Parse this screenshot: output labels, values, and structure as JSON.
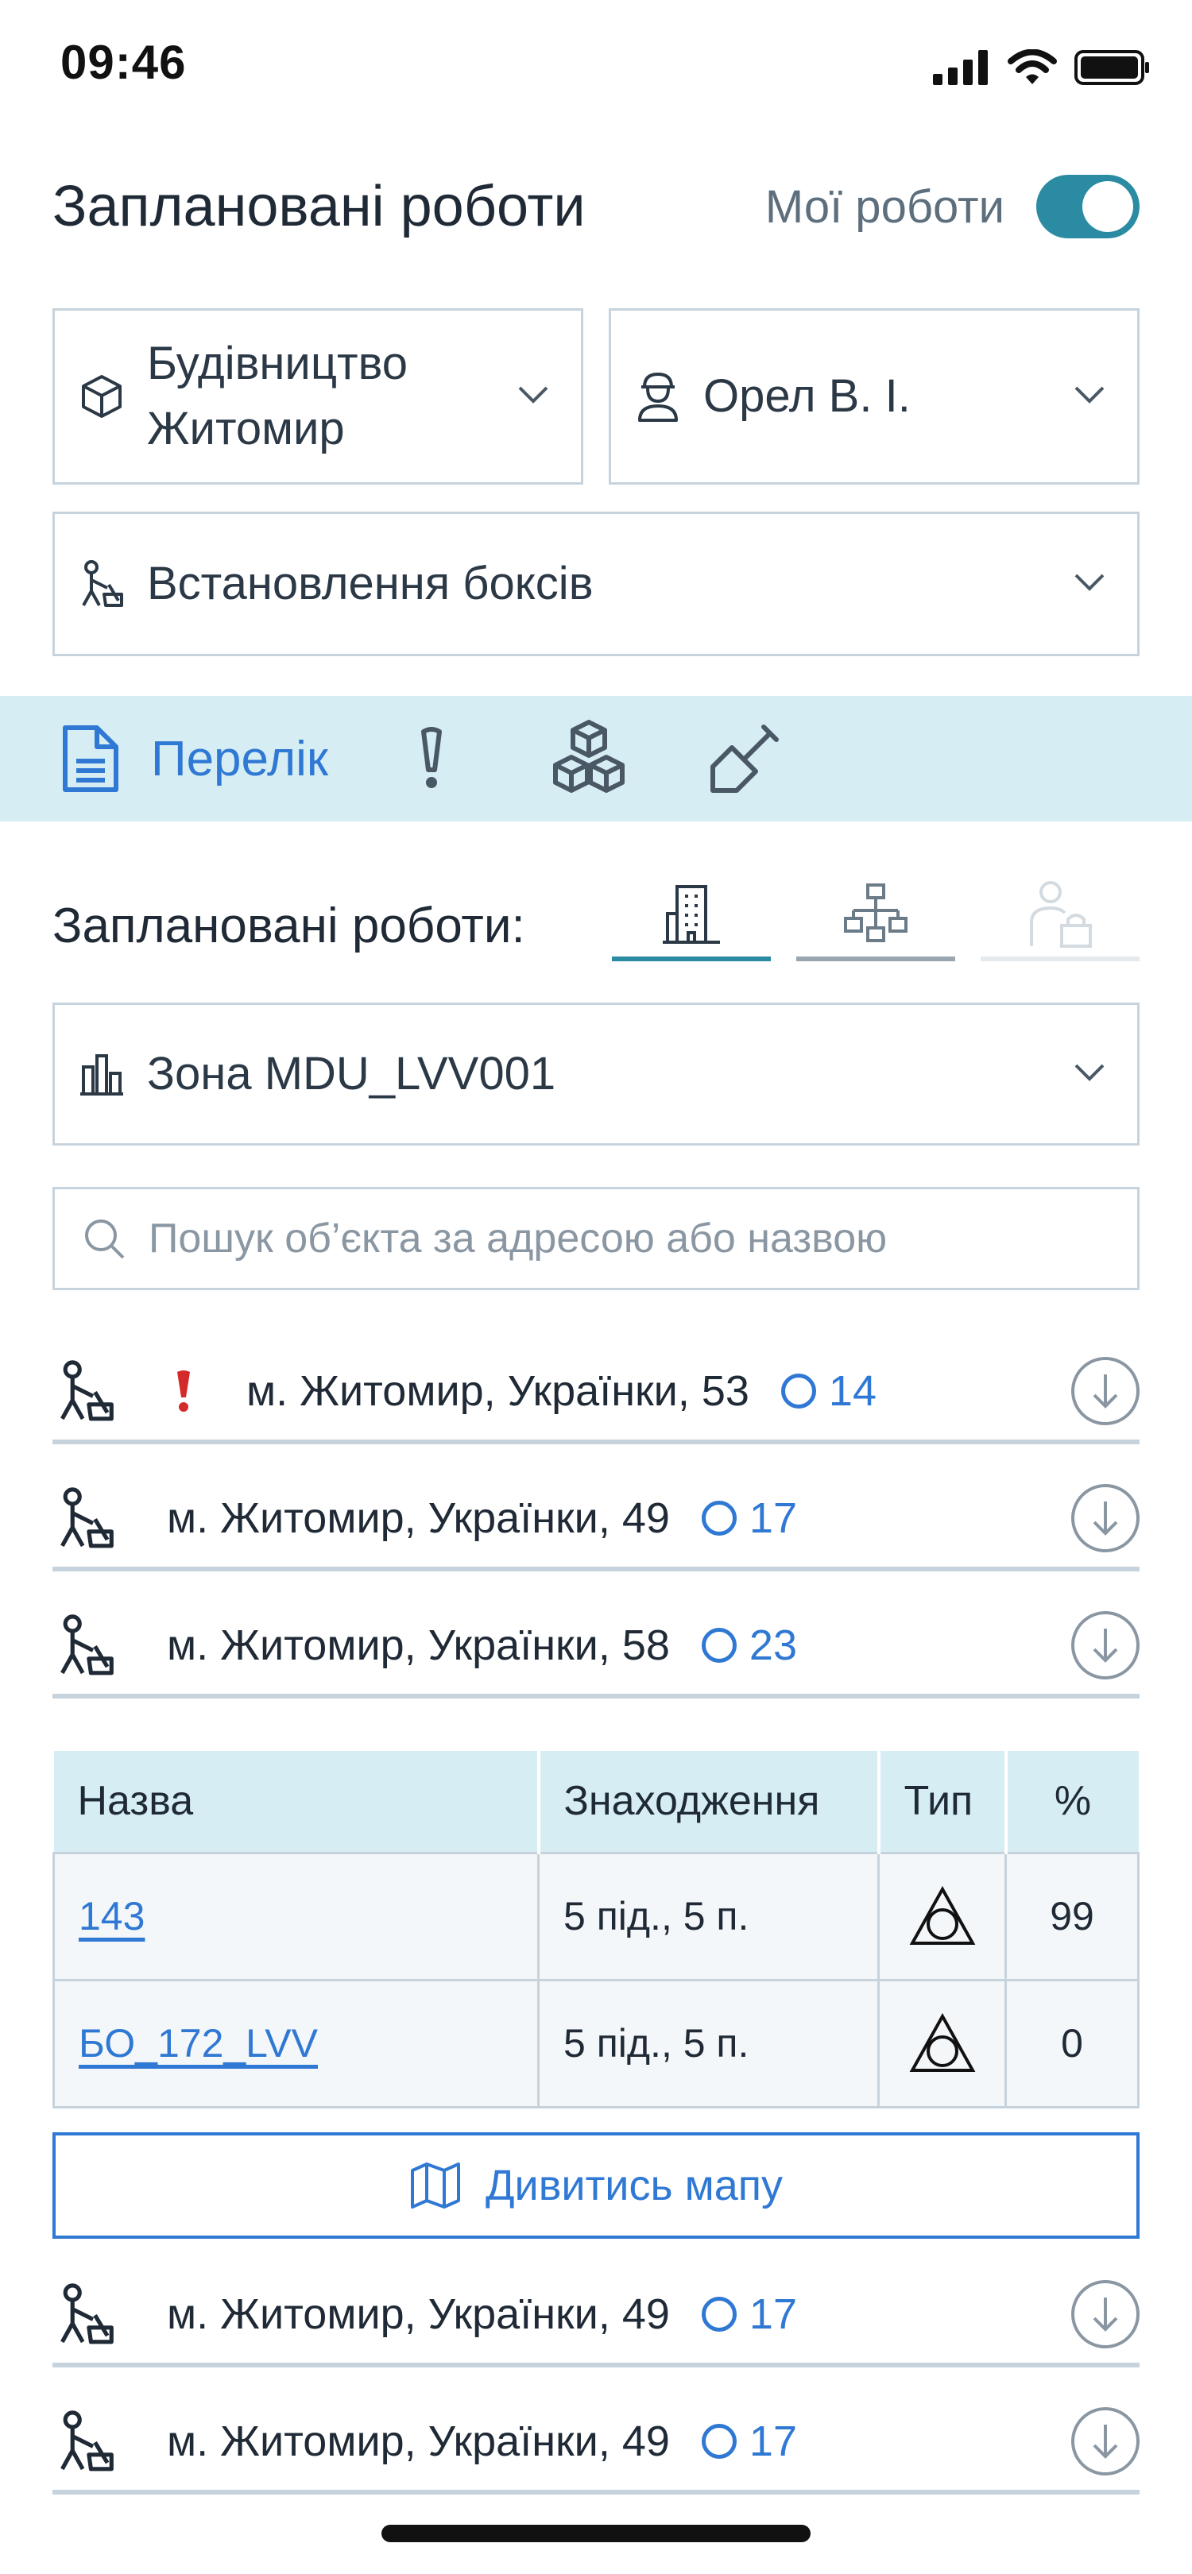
{
  "status": {
    "time": "09:46"
  },
  "header": {
    "title": "Заплановані роботи",
    "my_works_label": "Мої роботи",
    "my_works_on": true
  },
  "filters": {
    "project": {
      "line1": "Будівництво",
      "line2": "Житомир",
      "icon": "cube-icon"
    },
    "worker": {
      "value": "Орел В. І.",
      "icon": "worker-icon"
    },
    "work_type": {
      "value": "Встановлення боксів",
      "icon": "digger-icon"
    }
  },
  "tabbar": {
    "active_label": "Перелік"
  },
  "section": {
    "title": "Заплановані роботи:"
  },
  "zone": {
    "value": "Зона MDU_LVV001"
  },
  "search": {
    "placeholder": "Пошук об’єкта за адресою або назвою"
  },
  "objects_top": [
    {
      "address": "м. Житомир, Українки, 53",
      "count": "14",
      "alert": true
    },
    {
      "address": "м. Житомир, Українки, 49",
      "count": "17",
      "alert": false
    },
    {
      "address": "м. Житомир, Українки, 58",
      "count": "23",
      "alert": false
    }
  ],
  "table": {
    "headers": [
      "Назва",
      "Знаходження",
      "Тип",
      "%"
    ],
    "rows": [
      {
        "name": "143",
        "location": "5 під., 5 п.",
        "percent": "99"
      },
      {
        "name": "БО_172_LVV",
        "location": "5 під., 5 п.",
        "percent": "0"
      }
    ]
  },
  "map_button": {
    "label": "Дивитись мапу"
  },
  "objects_bottom": [
    {
      "address": "м. Житомир, Українки, 49",
      "count": "17"
    },
    {
      "address": "м. Житомир, Українки, 49",
      "count": "17"
    }
  ]
}
